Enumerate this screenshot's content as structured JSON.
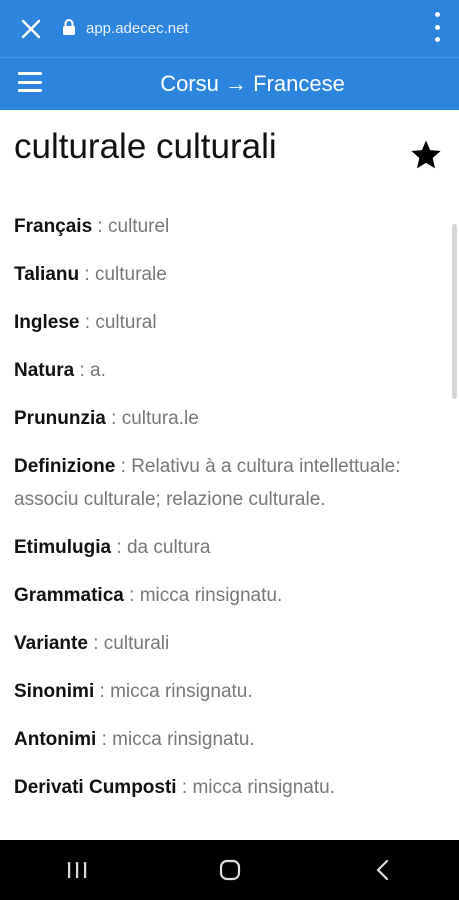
{
  "browser": {
    "url": "app.adecec.net",
    "close_icon": "close-icon",
    "lock_icon": "lock-icon",
    "menu_icon": "kebab-menu-icon"
  },
  "appbar": {
    "title": "Corsu → Francese",
    "menu_icon": "hamburger-menu-icon"
  },
  "entry": {
    "word": "culturale culturali",
    "favorite_icon": "star-icon",
    "fields": [
      {
        "label": "Français",
        "value": "culturel"
      },
      {
        "label": "Talianu",
        "value": "culturale"
      },
      {
        "label": "Inglese",
        "value": "cultural"
      },
      {
        "label": "Natura",
        "value": "a."
      },
      {
        "label": "Prununzia",
        "value": "cultura.le"
      },
      {
        "label": "Definizione",
        "value": "Relativu à a cultura intellettuale: associu culturale; relazione culturale."
      },
      {
        "label": "Etimulugia",
        "value": "da cultura"
      },
      {
        "label": "Grammatica",
        "value": "micca rinsignatu."
      },
      {
        "label": "Variante",
        "value": "culturali"
      },
      {
        "label": "Sinonimi",
        "value": "micca rinsignatu."
      },
      {
        "label": "Antonimi",
        "value": "micca rinsignatu."
      },
      {
        "label": "Derivati Cumposti",
        "value": "micca rinsignatu."
      }
    ],
    "separator": " : "
  },
  "colors": {
    "accent": "#2c84dd",
    "label": "#111111",
    "value": "#777777",
    "nav": "#000000"
  },
  "system_nav": {
    "recents_icon": "recent-apps-icon",
    "home_icon": "home-icon",
    "back_icon": "back-icon"
  }
}
